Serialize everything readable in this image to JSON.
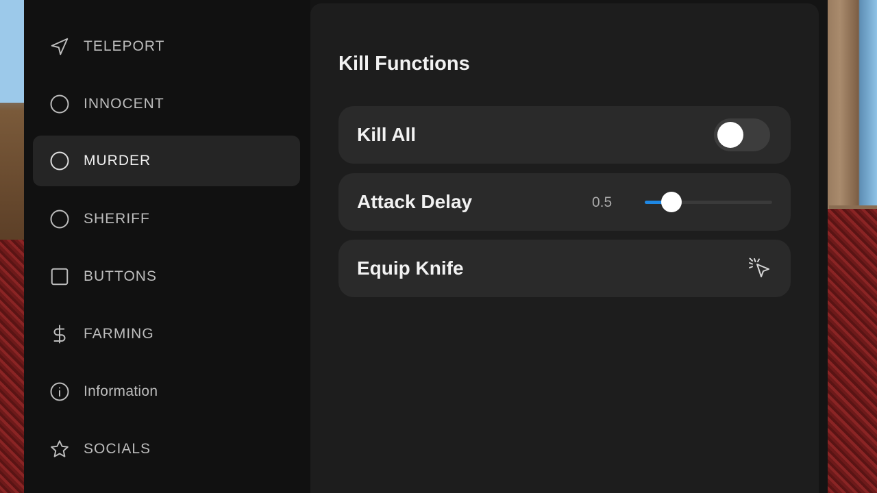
{
  "sidebar": {
    "items": [
      {
        "label": "TELEPORT",
        "icon": "navigation-arrow-icon",
        "active": false
      },
      {
        "label": "INNOCENT",
        "icon": "circle-icon",
        "active": false
      },
      {
        "label": "MURDER",
        "icon": "circle-icon",
        "active": true
      },
      {
        "label": "SHERIFF",
        "icon": "circle-icon",
        "active": false
      },
      {
        "label": "BUTTONS",
        "icon": "square-icon",
        "active": false
      },
      {
        "label": "FARMING",
        "icon": "dollar-icon",
        "active": false
      },
      {
        "label": "Information",
        "icon": "info-icon",
        "active": false
      },
      {
        "label": "SOCIALS",
        "icon": "star-icon",
        "active": false
      }
    ]
  },
  "main": {
    "section_title": "Kill Functions",
    "kill_all": {
      "label": "Kill All",
      "enabled": false
    },
    "attack_delay": {
      "label": "Attack Delay",
      "value": "0.5",
      "fraction": 0.21
    },
    "equip_knife": {
      "label": "Equip Knife",
      "icon": "click-pointer-icon"
    }
  },
  "colors": {
    "accent": "#1e88e5",
    "panel": "#1d1d1d",
    "sidebar": "#111111",
    "row": "#2a2a2a"
  }
}
